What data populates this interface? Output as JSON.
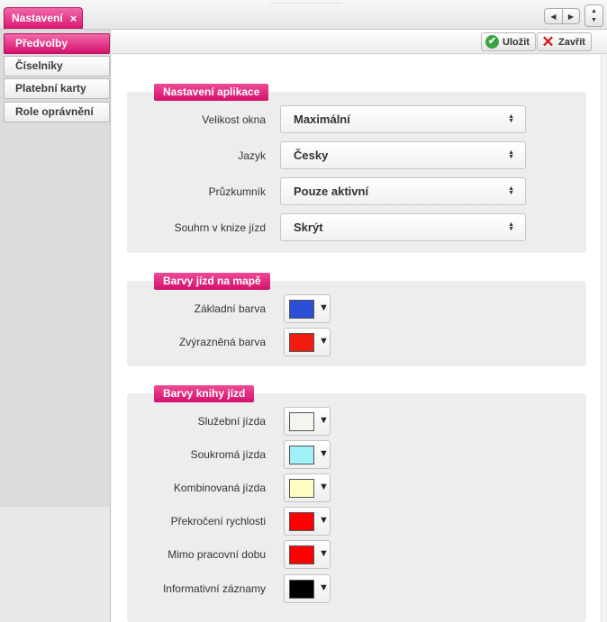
{
  "tab": {
    "title": "Nastavení",
    "close": "×"
  },
  "nav": {
    "prev": "◀",
    "next": "▶",
    "up": "▲",
    "down": "▼"
  },
  "sidebar": {
    "items": [
      {
        "label": "Předvolby",
        "active": true
      },
      {
        "label": "Číselníky",
        "active": false
      },
      {
        "label": "Platební karty",
        "active": false
      },
      {
        "label": "Role oprávnění",
        "active": false
      }
    ]
  },
  "toolbar": {
    "save_label": "Uložit",
    "close_label": "Zavřít"
  },
  "sections": {
    "app": {
      "title": "Nastavení aplikace",
      "rows": [
        {
          "label": "Velikost okna",
          "value": "Maximální"
        },
        {
          "label": "Jazyk",
          "value": "Česky"
        },
        {
          "label": "Průzkumník",
          "value": "Pouze aktivní"
        },
        {
          "label": "Souhrn v knize jízd",
          "value": "Skrýt"
        }
      ]
    },
    "map_colors": {
      "title": "Barvy jízd na mapě",
      "rows": [
        {
          "label": "Základní barva",
          "color": "#2a4fd6"
        },
        {
          "label": "Zvýrazněná barva",
          "color": "#f21b0f"
        }
      ]
    },
    "book_colors": {
      "title": "Barvy knihy jízd",
      "rows": [
        {
          "label": "Služební jízda",
          "color": "#f5f5ef"
        },
        {
          "label": "Soukromá jízda",
          "color": "#9ff0f8"
        },
        {
          "label": "Kombinovaná jízda",
          "color": "#fdfcc2"
        },
        {
          "label": "Překročení rychlosti",
          "color": "#ff0000"
        },
        {
          "label": "Mimo pracovní dobu",
          "color": "#ff0000"
        },
        {
          "label": "Informativní záznamy",
          "color": "#000000"
        }
      ]
    }
  },
  "colors": {
    "accent": "#d8136f"
  }
}
